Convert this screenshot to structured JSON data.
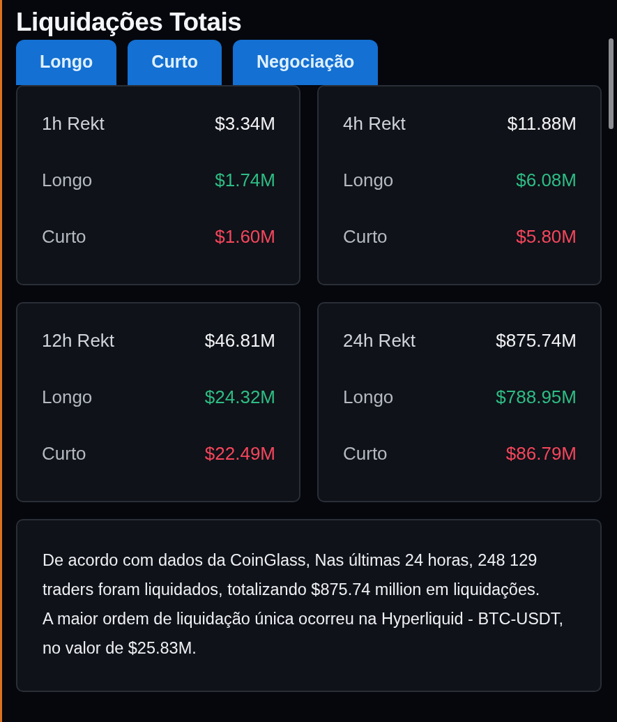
{
  "title": "Liquidações Totais",
  "tabs": [
    {
      "label": "Longo"
    },
    {
      "label": "Curto"
    },
    {
      "label": "Negociação"
    }
  ],
  "cards": [
    {
      "rows": [
        {
          "kind": "total",
          "label": "1h Rekt",
          "value": "$3.34M"
        },
        {
          "kind": "long",
          "label": "Longo",
          "value": "$1.74M"
        },
        {
          "kind": "short",
          "label": "Curto",
          "value": "$1.60M"
        }
      ]
    },
    {
      "rows": [
        {
          "kind": "total",
          "label": "4h Rekt",
          "value": "$11.88M"
        },
        {
          "kind": "long",
          "label": "Longo",
          "value": "$6.08M"
        },
        {
          "kind": "short",
          "label": "Curto",
          "value": "$5.80M"
        }
      ]
    },
    {
      "rows": [
        {
          "kind": "total",
          "label": "12h Rekt",
          "value": "$46.81M"
        },
        {
          "kind": "long",
          "label": "Longo",
          "value": "$24.32M"
        },
        {
          "kind": "short",
          "label": "Curto",
          "value": "$22.49M"
        }
      ]
    },
    {
      "rows": [
        {
          "kind": "total",
          "label": "24h Rekt",
          "value": "$875.74M"
        },
        {
          "kind": "long",
          "label": "Longo",
          "value": "$788.95M"
        },
        {
          "kind": "short",
          "label": "Curto",
          "value": "$86.79M"
        }
      ]
    }
  ],
  "summary": [
    "De acordo com dados da CoinGlass, Nas últimas 24 horas, 248 129 traders foram liquidados, totalizando $875.74 million em liquidações.",
    "A maior ordem de liquidação única ocorreu na Hyperliquid - BTC-USDT, no valor de $25.83M."
  ]
}
